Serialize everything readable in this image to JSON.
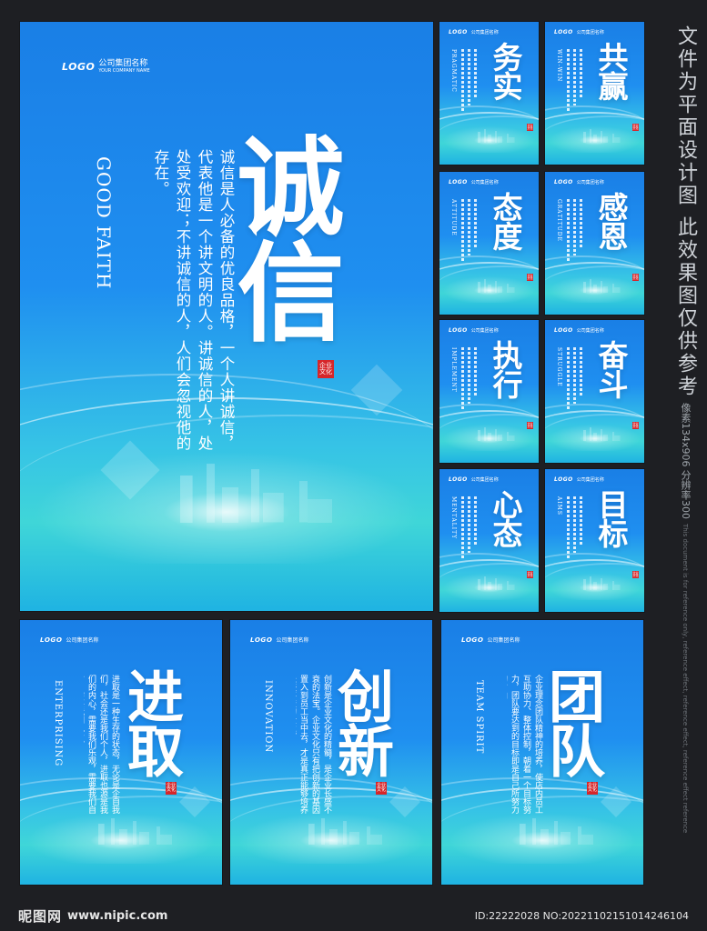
{
  "company": {
    "logo": "LOGO",
    "name": "公司集团名称",
    "name_en": "YOUR COMPANY NAME"
  },
  "seal_text": "企业\n文化",
  "main_poster": {
    "title": "诚信",
    "english": "GOOD FAITH",
    "body": "诚信是人必备的优良品格，一个人讲诚信，代表他是一个讲文明的人。讲诚信的人，处处受欢迎；不讲诚信的人，人们会忽视他的存在。"
  },
  "small_posters": [
    {
      "title": "务实",
      "english": "PRAGMATIC"
    },
    {
      "title": "共赢",
      "english": "WIN-WIN"
    },
    {
      "title": "态度",
      "english": "ATTITUDE"
    },
    {
      "title": "感恩",
      "english": "GRATITUDE"
    },
    {
      "title": "执行",
      "english": "IMPLEMENT"
    },
    {
      "title": "奋斗",
      "english": "STRUGGLE"
    },
    {
      "title": "心态",
      "english": "MENTALITY"
    },
    {
      "title": "目标",
      "english": "AIMS"
    }
  ],
  "bottom_posters": [
    {
      "title": "进取",
      "english": "ENTERPRISING",
      "body": "进取是一种生存的状态，无论是企自我们，社会还是我们个人，进取也源是我们的内心，需要我们乐观，需要我们自信，需要我们执着。"
    },
    {
      "title": "创新",
      "english": "INNOVATION",
      "body": "创新是企业文化的精髓，是企业长盛不衰的法宝。企业文化只有把创新的基因置入到员工当中去，才是真正能够培养长盛不衰的企业。"
    },
    {
      "title": "团队",
      "english": "TEAM SPIRIT",
      "body": "企业理念团队精神的培养，使店内员工互助协力、整体控制，朝着一个目标努力，团队要达到的目标即是自己所努力的方向"
    }
  ],
  "side_note": {
    "main": "文件为平面设计图 此效果图仅供参考",
    "pixel": "像素134x906 分辨率300",
    "english": "This document is for reference only, reference effect, reference effect, reference effect reference"
  },
  "watermark": {
    "site_cn": "昵图网",
    "site_url": "www.nipic.com",
    "id_line": "ID:22222028 NO:20221102151014246104"
  }
}
